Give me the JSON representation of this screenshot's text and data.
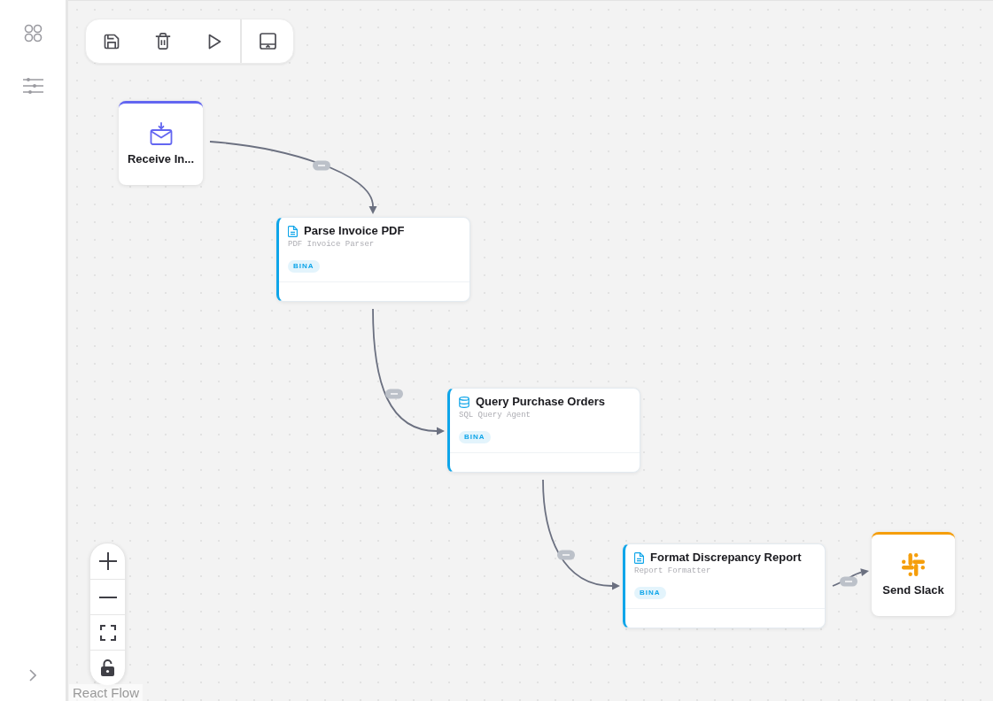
{
  "nodes": [
    {
      "kind": "trigger",
      "label": "Receive In...",
      "color": "#6366f1"
    },
    {
      "kind": "step",
      "title": "Parse Invoice PDF",
      "subtitle": "PDF Invoice Parser",
      "badge": "BINA",
      "color": "#0ea5e9"
    },
    {
      "kind": "step",
      "title": "Query Purchase Orders",
      "subtitle": "SQL Query Agent",
      "badge": "BINA",
      "color": "#0ea5e9"
    },
    {
      "kind": "step",
      "title": "Format Discrepancy Report",
      "subtitle": "Report Formatter",
      "badge": "BINA",
      "color": "#0ea5e9"
    },
    {
      "kind": "trigger",
      "label": "Send Slack",
      "color": "#f59e0b"
    }
  ],
  "attribution": "React Flow"
}
